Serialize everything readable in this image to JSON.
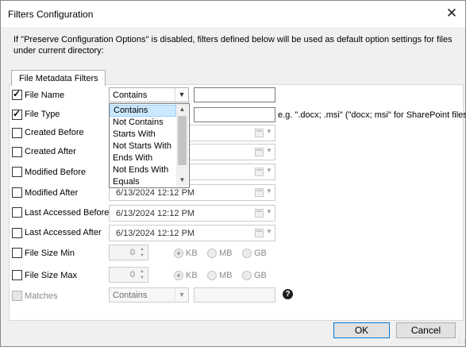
{
  "dialog": {
    "title": "Filters Configuration",
    "close_glyph": "✕",
    "description": "If \"Preserve Configuration Options\" is disabled, filters defined below will be used as default option settings for files under current directory:",
    "tab_label": "File Metadata Filters",
    "ok_label": "OK",
    "cancel_label": "Cancel"
  },
  "filters": {
    "file_name": {
      "label": "File Name",
      "checked": true,
      "operator": "Contains",
      "value": ""
    },
    "file_type": {
      "label": "File Type",
      "checked": true,
      "value": "",
      "hint": "e.g. \".docx; .msi\" (\"docx; msi\" for SharePoint files)"
    },
    "created_before": {
      "label": "Created Before",
      "checked": false,
      "value": ""
    },
    "created_after": {
      "label": "Created After",
      "checked": false,
      "value": ""
    },
    "modified_before": {
      "label": "Modified Before",
      "checked": false,
      "value": ""
    },
    "modified_after": {
      "label": "Modified After",
      "checked": false,
      "value": "6/13/2024 12:12 PM"
    },
    "last_accessed_before": {
      "label": "Last Accessed Before",
      "checked": false,
      "value": "6/13/2024 12:12 PM"
    },
    "last_accessed_after": {
      "label": "Last Accessed After",
      "checked": false,
      "value": "6/13/2024 12:12 PM"
    },
    "file_size_min": {
      "label": "File Size Min",
      "checked": false,
      "value": "0",
      "units": [
        "KB",
        "MB",
        "GB"
      ],
      "selected_unit": "KB"
    },
    "file_size_max": {
      "label": "File Size Max",
      "checked": false,
      "value": "0",
      "units": [
        "KB",
        "MB",
        "GB"
      ],
      "selected_unit": "KB"
    },
    "matches": {
      "label": "Matches",
      "checked": false,
      "operator": "Contains",
      "value": ""
    }
  },
  "operator_dropdown": {
    "open": true,
    "highlighted": "Contains",
    "options": [
      "Contains",
      "Not Contains",
      "Starts With",
      "Not Starts With",
      "Ends With",
      "Not Ends With",
      "Equals"
    ]
  },
  "icons": {
    "checkbox_check": "check-icon",
    "dropdown": "chevron-down-icon",
    "calendar": "calendar-icon",
    "help": "question-icon"
  },
  "colors": {
    "dialog_bg": "#f0f0f0",
    "panel_bg": "#ffffff",
    "highlight": "#cce8ff",
    "primary_border": "#0078d7"
  }
}
